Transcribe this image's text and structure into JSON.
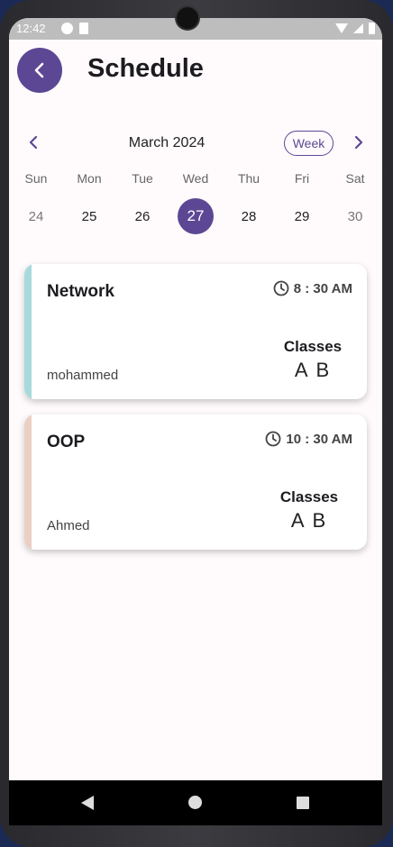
{
  "status_bar": {
    "time": "12:42"
  },
  "header": {
    "title": "Schedule",
    "back_icon": "chevron-left-icon"
  },
  "calendar": {
    "month_label": "March 2024",
    "view_toggle_label": "Week",
    "days": [
      {
        "name": "Sun",
        "number": "24",
        "selected": false
      },
      {
        "name": "Mon",
        "number": "25",
        "selected": false
      },
      {
        "name": "Tue",
        "number": "26",
        "selected": false
      },
      {
        "name": "Wed",
        "number": "27",
        "selected": true
      },
      {
        "name": "Thu",
        "number": "28",
        "selected": false
      },
      {
        "name": "Fri",
        "number": "29",
        "selected": false
      },
      {
        "name": "Sat",
        "number": "30",
        "selected": false
      }
    ]
  },
  "events": [
    {
      "title": "Network",
      "time": "8 : 30 AM",
      "person": "mohammed",
      "classes_label": "Classes",
      "classes_value": "A B",
      "stripe_color": "#a8dadc"
    },
    {
      "title": "OOP",
      "time": "10 : 30 AM",
      "person": "Ahmed",
      "classes_label": "Classes",
      "classes_value": "A B",
      "stripe_color": "#eccfc3"
    }
  ],
  "colors": {
    "accent": "#5c4794"
  }
}
